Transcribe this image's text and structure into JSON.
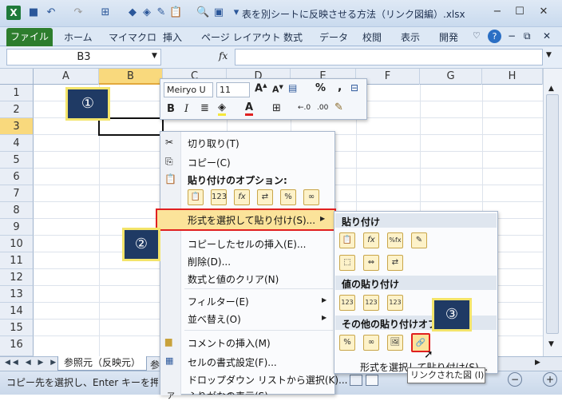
{
  "window": {
    "title": "表を別シートに反映させる方法（リンク図編）.xlsx",
    "min": "−",
    "max": "☐",
    "close": "✕"
  },
  "ribbon": {
    "file": "ファイル",
    "tabs": [
      "ホーム",
      "マイマクロ",
      "挿入",
      "ページ レイアウト",
      "数式",
      "データ",
      "校閲",
      "表示",
      "開発"
    ]
  },
  "formula_bar": {
    "name_box": "B3",
    "fx": "fx",
    "value": ""
  },
  "columns": [
    "A",
    "B",
    "C",
    "D",
    "E",
    "F",
    "G",
    "H"
  ],
  "rows": [
    "1",
    "2",
    "3",
    "4",
    "5",
    "6",
    "7",
    "8",
    "9",
    "10",
    "11",
    "12",
    "13",
    "14",
    "15",
    "16"
  ],
  "mini_toolbar": {
    "font": "Meiryo U",
    "size": "11",
    "percent": "%",
    "comma": ",",
    "bold": "B",
    "italic": "I",
    "font_a": "A"
  },
  "context_menu": {
    "cut": "切り取り(T)",
    "copy": "コピー(C)",
    "paste_options_header": "貼り付けのオプション:",
    "paste_icons": [
      "📋",
      "123",
      "fx",
      "⇄",
      "%",
      "∞"
    ],
    "paste_special": "形式を選択して貼り付け(S)...",
    "insert_copied": "コピーしたセルの挿入(E)...",
    "delete": "削除(D)...",
    "clear": "数式と値のクリア(N)",
    "filter": "フィルター(E)",
    "sort": "並べ替え(O)",
    "insert_comment": "コメントの挿入(M)",
    "format_cells": "セルの書式設定(F)...",
    "dropdown": "ドロップダウン リストから選択(K)...",
    "phonetic": "ふりがなの表示(S)"
  },
  "submenu": {
    "paste_header": "貼り付け",
    "paste_icons": [
      "📋",
      "fx",
      "%fx",
      "✎",
      "⬚",
      "⇔",
      "⇄"
    ],
    "values_header": "値の貼り付け",
    "values_icons": [
      "123",
      "123",
      "123"
    ],
    "other_header": "その他の貼り付けオプション",
    "other_icons": [
      "%",
      "∞",
      "🖼",
      "🔗"
    ],
    "paste_special": "形式を選択して貼り付け(S)..."
  },
  "tooltip": "リンクされた図 (I)",
  "badges": [
    "①",
    "②",
    "③"
  ],
  "sheet_tabs": {
    "active": "参照元（反映元）",
    "next": "参"
  },
  "status": "コピー先を選択し、Enter キーを押すか、貼り付けを選択します。",
  "colors": {
    "accent": "#2b579a",
    "highlight": "#e02020",
    "badge_bg": "#1f3a64",
    "badge_border": "#f3e46a",
    "menu_hover": "#fbe39a"
  }
}
